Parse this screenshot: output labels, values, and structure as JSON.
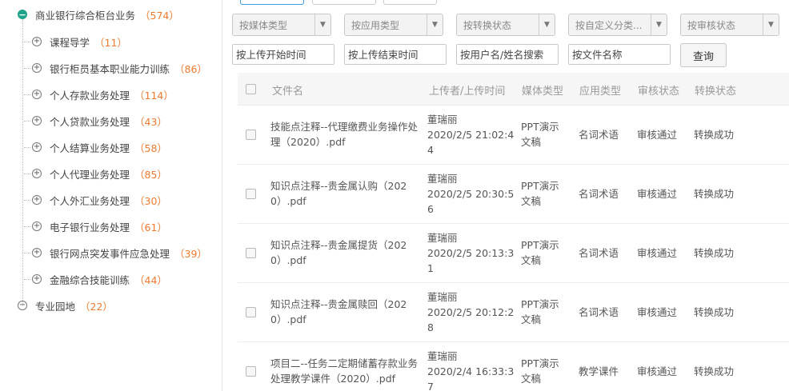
{
  "tree": {
    "root": {
      "label": "商业银行综合柜台业务",
      "count": "（574）"
    },
    "children": [
      {
        "label": "课程导学",
        "count": "（11）"
      },
      {
        "label": "银行柜员基本职业能力训练",
        "count": "（86）"
      },
      {
        "label": "个人存款业务处理",
        "count": "（114）"
      },
      {
        "label": "个人贷款业务处理",
        "count": "（43）"
      },
      {
        "label": "个人结算业务处理",
        "count": "（58）"
      },
      {
        "label": "个人代理业务处理",
        "count": "（85）"
      },
      {
        "label": "个人外汇业务处理",
        "count": "（30）"
      },
      {
        "label": "电子银行业务处理",
        "count": "（61）"
      },
      {
        "label": "银行网点突发事件应急处理",
        "count": "（39）"
      },
      {
        "label": "金融综合技能训练",
        "count": "（44）"
      }
    ],
    "sibling": {
      "label": "专业园地",
      "count": "（22）"
    }
  },
  "filters": {
    "selects": [
      "按媒体类型",
      "按应用类型",
      "按转换状态",
      "按自定义分类...",
      "按审核状态"
    ],
    "start_time": "按上传开始时间",
    "end_time": "按上传结束时间",
    "user": "按用户名/姓名搜索",
    "filename": "按文件名称",
    "query_label": "查询"
  },
  "table": {
    "headers": {
      "name": "文件名",
      "uploader": "上传者/上传时间",
      "media": "媒体类型",
      "app": "应用类型",
      "review": "审核状态",
      "convert": "转换状态"
    },
    "rows": [
      {
        "name1": "技能点注释--代理缴费业务操作处",
        "name2": "理（2020）.pdf",
        "user": "董瑞丽",
        "t1": "2020/2/5 21:02:4",
        "t2": "4",
        "media1": "PPT演示",
        "media2": "文稿",
        "app": "名词术语",
        "review": "审核通过",
        "convert": "转换成功"
      },
      {
        "name1": "知识点注释--贵金属认购（202",
        "name2": "0）.pdf",
        "user": "董瑞丽",
        "t1": "2020/2/5 20:30:5",
        "t2": "6",
        "media1": "PPT演示",
        "media2": "文稿",
        "app": "名词术语",
        "review": "审核通过",
        "convert": "转换成功"
      },
      {
        "name1": "知识点注释--贵金属提货（202",
        "name2": "0）.pdf",
        "user": "董瑞丽",
        "t1": "2020/2/5 20:13:3",
        "t2": "1",
        "media1": "PPT演示",
        "media2": "文稿",
        "app": "名词术语",
        "review": "审核通过",
        "convert": "转换成功"
      },
      {
        "name1": "知识点注释--贵金属赎回（202",
        "name2": "0）.pdf",
        "user": "董瑞丽",
        "t1": "2020/2/5 20:12:2",
        "t2": "8",
        "media1": "PPT演示",
        "media2": "文稿",
        "app": "名词术语",
        "review": "审核通过",
        "convert": "转换成功"
      },
      {
        "name1": "项目二--任务二定期储蓄存款业务",
        "name2": "处理教学课件（2020）.pdf",
        "user": "董瑞丽",
        "t1": "2020/2/4 16:33:3",
        "t2": "7",
        "media1": "PPT演示",
        "media2": "文稿",
        "app": "教学课件",
        "review": "审核通过",
        "convert": "转换成功"
      }
    ]
  }
}
